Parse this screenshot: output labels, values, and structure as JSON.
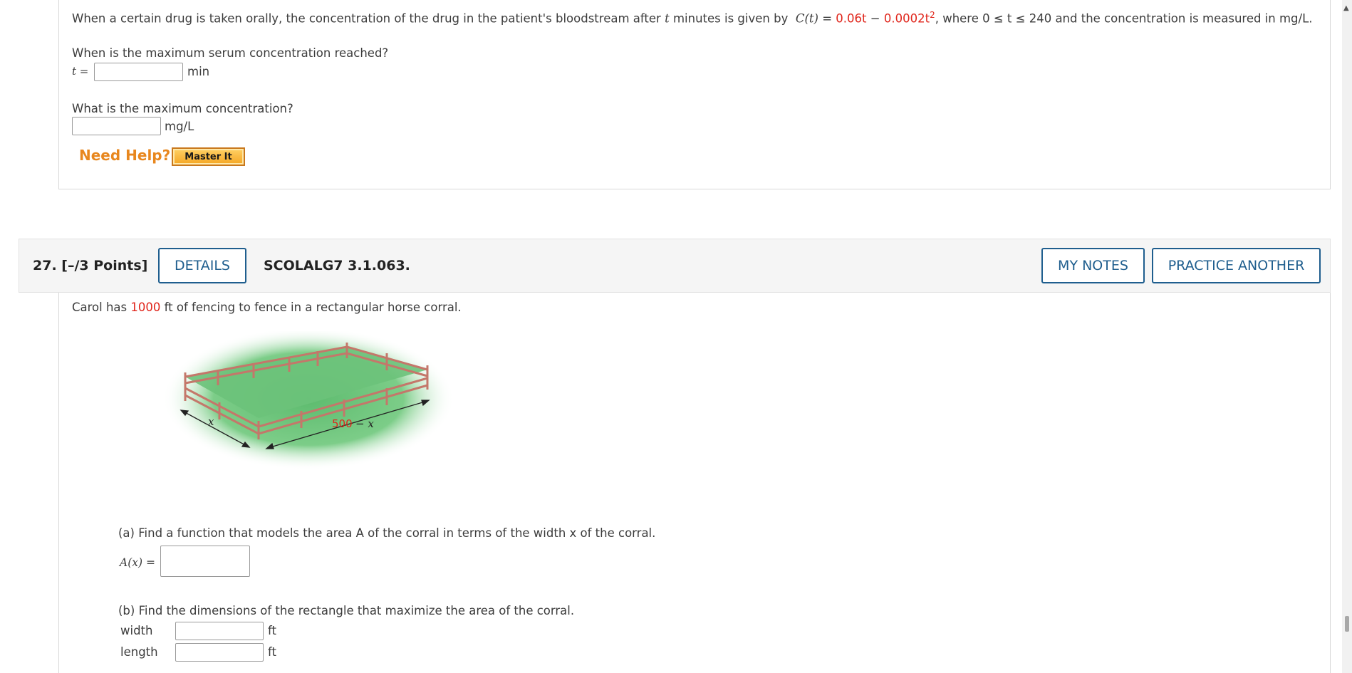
{
  "q26": {
    "stem_prefix": "When a certain drug is taken orally, the concentration of the drug in the patient's bloodstream after",
    "stem_var": "t",
    "stem_mid": "minutes is given by",
    "fn_name": "C(t)",
    "eq": "=",
    "coef1": "0.06t",
    "minus": "−",
    "coef2": "0.0002t",
    "exp": "2",
    "stem_suffix": ", where 0 ≤ t ≤ 240 and the concentration is measured in mg/L.",
    "q1": "When is the maximum serum concentration reached?",
    "q1_var": "t =",
    "q1_unit": "min",
    "q2": "What is the maximum concentration?",
    "q2_unit": "mg/L",
    "need_help": "Need Help?",
    "master_it": "Master It"
  },
  "q27": {
    "number": "27.",
    "points": "[–/3 Points]",
    "details": "DETAILS",
    "code": "SCOLALG7 3.1.063.",
    "my_notes": "MY NOTES",
    "practice": "PRACTICE ANOTHER",
    "stem_pre": "Carol has",
    "stem_num": "1000",
    "stem_post": "ft of fencing to fence in a rectangular horse corral.",
    "fig_label_x": "x",
    "fig_label_len_num": "500",
    "fig_label_len_rest": "− x",
    "part_a": "(a) Find a function that models the area A of the corral in terms of the width x of the corral.",
    "part_a_label": "A(x) =",
    "part_b": "(b) Find the dimensions of the rectangle that maximize the area of the corral.",
    "width_label": "width",
    "length_label": "length",
    "unit_ft": "ft"
  },
  "colors": {
    "accent": "#1f5e8e",
    "red": "#e0261c",
    "help": "#e8871e",
    "grass": "#6cc27a",
    "fence": "#c4776a"
  }
}
